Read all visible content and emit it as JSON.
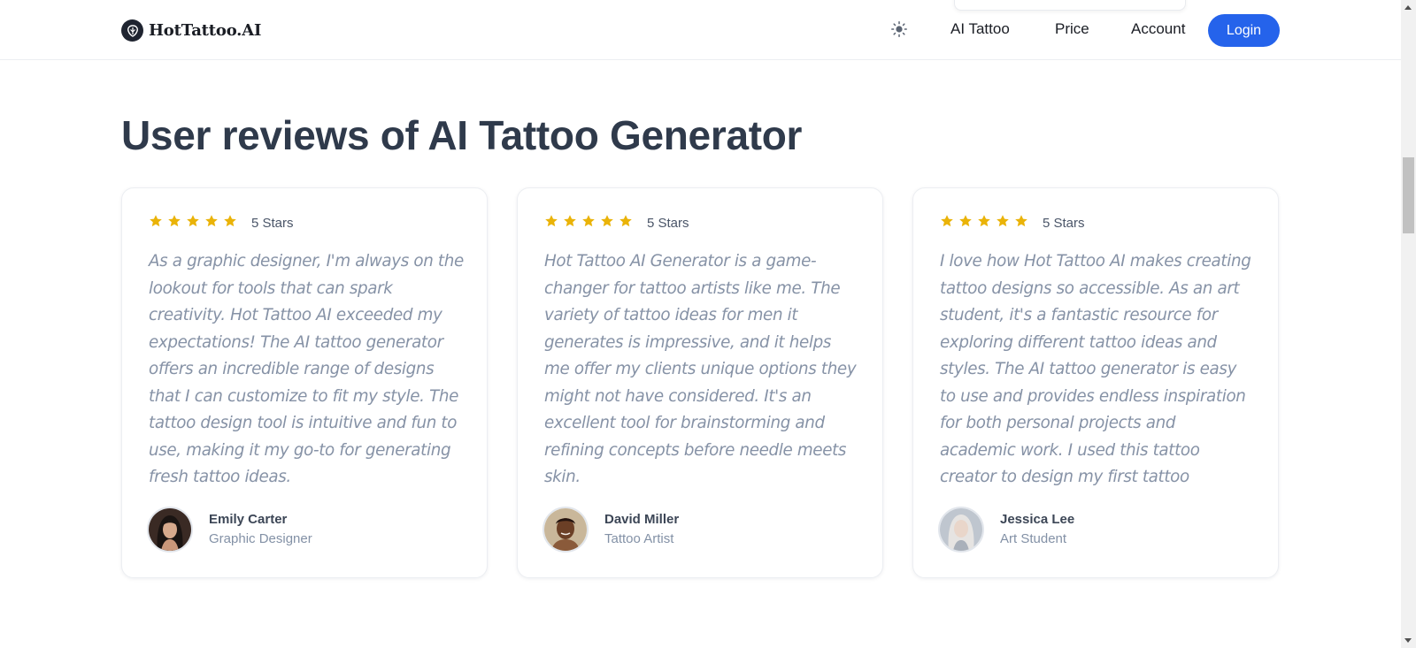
{
  "header": {
    "brand": "HotTattoo.AI",
    "nav": {
      "ai_tattoo": "AI Tattoo",
      "price": "Price",
      "account": "Account"
    },
    "login_label": "Login",
    "theme_icon": "sun-icon"
  },
  "section": {
    "title": "User reviews of AI Tattoo Generator"
  },
  "colors": {
    "accent": "#2563eb",
    "star": "#eab308",
    "title": "#2f3a4b",
    "review_text": "#8692a6"
  },
  "reviews": [
    {
      "rating": 5,
      "stars_label": "5 Stars",
      "text": "As a graphic designer, I'm always on the lookout for tools that can spark creativity. Hot Tattoo AI exceeded my expectations! The AI tattoo generator offers an incredible range of designs that I can customize to fit my style. The tattoo design tool is intuitive and fun to use, making it my go-to for generating fresh tattoo ideas.",
      "name": "Emily Carter",
      "role": "Graphic Designer"
    },
    {
      "rating": 5,
      "stars_label": "5 Stars",
      "text": "Hot Tattoo AI Generator is a game-changer for tattoo artists like me. The variety of tattoo ideas for men it generates is impressive, and it helps me offer my clients unique options they might not have considered. It's an excellent tool for brainstorming and refining concepts before needle meets skin.",
      "name": "David Miller",
      "role": "Tattoo Artist"
    },
    {
      "rating": 5,
      "stars_label": "5 Stars",
      "text": "I love how Hot Tattoo AI makes creating tattoo designs so accessible. As an art student, it's a fantastic resource for exploring different tattoo ideas and styles. The AI tattoo generator is easy to use and provides endless inspiration for both personal projects and academic work. I used this tattoo creator to design my first tattoo",
      "name": "Jessica Lee",
      "role": "Art Student"
    }
  ]
}
